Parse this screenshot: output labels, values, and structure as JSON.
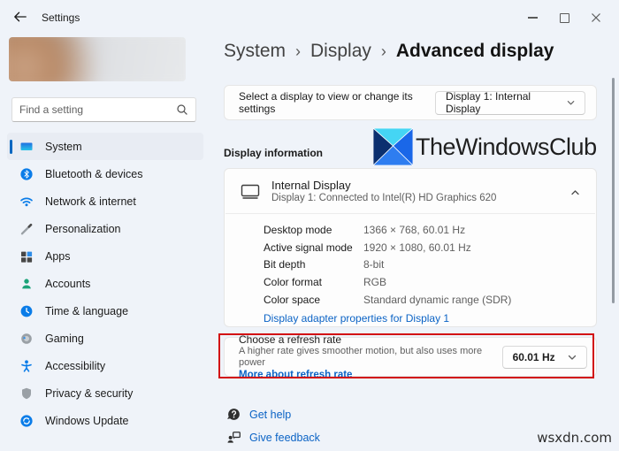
{
  "window": {
    "title": "Settings"
  },
  "sidebar": {
    "search_placeholder": "Find a setting",
    "items": [
      {
        "label": "System",
        "selected": true
      },
      {
        "label": "Bluetooth & devices"
      },
      {
        "label": "Network & internet"
      },
      {
        "label": "Personalization"
      },
      {
        "label": "Apps"
      },
      {
        "label": "Accounts"
      },
      {
        "label": "Time & language"
      },
      {
        "label": "Gaming"
      },
      {
        "label": "Accessibility"
      },
      {
        "label": "Privacy & security"
      },
      {
        "label": "Windows Update"
      }
    ]
  },
  "breadcrumb": {
    "items": [
      "System",
      "Display",
      "Advanced display"
    ],
    "separator": "›"
  },
  "display_selector": {
    "label": "Select a display to view or change its settings",
    "value": "Display 1: Internal Display"
  },
  "section_title": "Display information",
  "watermark_logo": {
    "text": "TheWindowsClub",
    "colors": {
      "top": "#45d5f4",
      "left": "#0b2f6f",
      "right": "#1a67e8",
      "bottom": "#2e7df0"
    }
  },
  "display_info": {
    "name": "Internal Display",
    "subtitle": "Display 1: Connected to Intel(R) HD Graphics 620",
    "rows": [
      {
        "label": "Desktop mode",
        "value": "1366 × 768, 60.01 Hz"
      },
      {
        "label": "Active signal mode",
        "value": "1920 × 1080, 60.01 Hz"
      },
      {
        "label": "Bit depth",
        "value": "8-bit"
      },
      {
        "label": "Color format",
        "value": "RGB"
      },
      {
        "label": "Color space",
        "value": "Standard dynamic range (SDR)"
      }
    ],
    "adapter_link": "Display adapter properties for Display 1"
  },
  "refresh_rate": {
    "title": "Choose a refresh rate",
    "description": "A higher rate gives smoother motion, but also uses more power",
    "link": "More about refresh rate",
    "value": "60.01 Hz",
    "highlight_color": "#d21114"
  },
  "footer_links": [
    {
      "label": "Get help"
    },
    {
      "label": "Give feedback"
    }
  ],
  "site_watermark": "wsxdn.com",
  "icons": {
    "sidebar": [
      "system-icon",
      "bluetooth-icon",
      "network-icon",
      "personalization-icon",
      "apps-icon",
      "accounts-icon",
      "time-language-icon",
      "gaming-icon",
      "accessibility-icon",
      "privacy-icon",
      "windows-update-icon"
    ],
    "other": [
      "back-arrow-icon",
      "search-icon",
      "monitor-icon",
      "chevron-up-icon",
      "chevron-down-icon",
      "help-icon",
      "feedback-icon",
      "minimize-icon",
      "maximize-icon",
      "close-icon"
    ]
  }
}
